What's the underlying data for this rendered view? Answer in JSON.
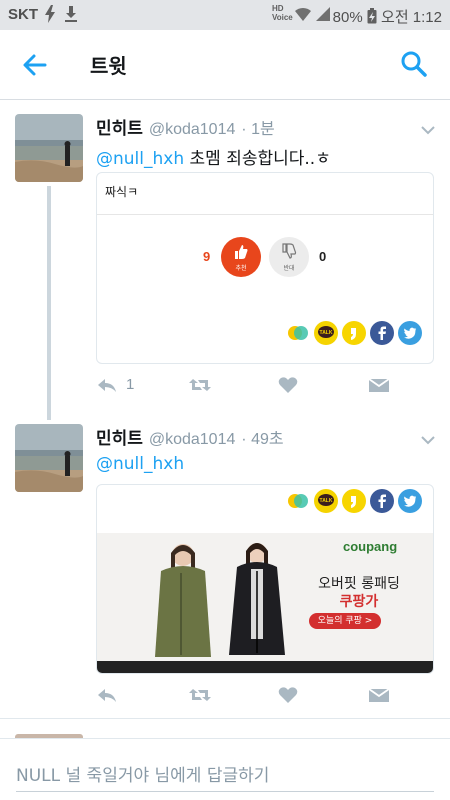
{
  "status_bar": {
    "carrier": "SKT",
    "battery": "80%",
    "time": "오전 1:12",
    "icons": [
      "lightning-icon",
      "download-icon",
      "hd-voice-icon",
      "wifi-icon",
      "signal-icon",
      "battery-charging-icon"
    ]
  },
  "app_bar": {
    "title": "트윗",
    "back_icon": "back-arrow-icon",
    "search_icon": "search-icon",
    "accent": "#1da1f2"
  },
  "tweets": [
    {
      "name": "민히트",
      "handle": "@koda1014",
      "time": "· 1분",
      "mention": "@null_hxh",
      "text": " 초멤 죄송합니다..ㅎ",
      "card": {
        "post_title": "짜식ㅋ",
        "upvotes": "9",
        "upvote_label": "추천",
        "downvotes": "0",
        "downvote_label": "반대"
      },
      "reply_count": "1"
    },
    {
      "name": "민히트",
      "handle": "@koda1014",
      "time": "· 49초",
      "mention": "@null_hxh",
      "card": {
        "ad_brand": "coupang",
        "ad_line1": "오버핏 롱패딩",
        "ad_line2": "쿠팡가",
        "ad_button": "오늘의 쿠팡 >"
      }
    }
  ],
  "reply_bar": {
    "placeholder": "NULL 널 죽일거야 님에게 답글하기"
  }
}
